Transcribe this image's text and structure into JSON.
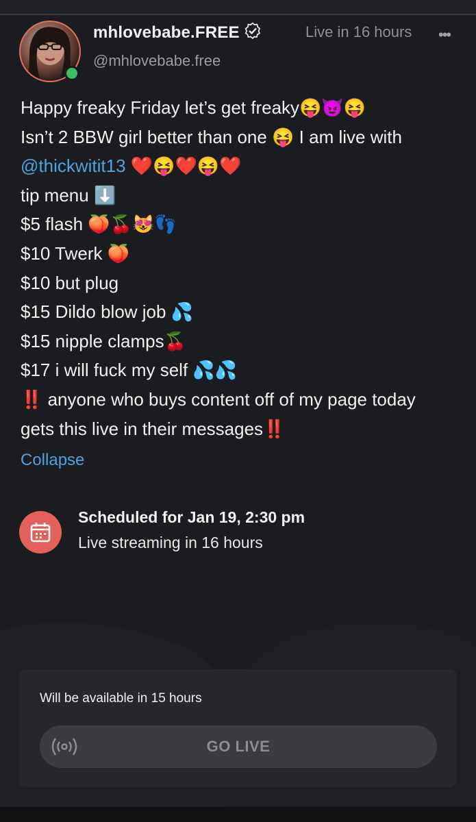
{
  "header": {
    "username": "mhlovebabe.FREE",
    "handle": "@mhlovebabe.free",
    "live_status": "Live in 16 hours",
    "more_label": "•••"
  },
  "post": {
    "lines": [
      "Happy freaky Friday let’s get freaky😝😈😝",
      "Isn’t 2 BBW girl better than one 😝 I am live with",
      {
        "mention": "@thickwitit13",
        "rest": " ❤️😝❤️😝❤️"
      },
      "tip menu ⬇️",
      "$5 flash 🍑🍒😻👣",
      "$10 Twerk 🍑",
      "$10 but plug",
      "$15 Dildo blow job 💦",
      "$15 nipple clamps🍒",
      "$17 i will fuck my self 💦💦",
      "‼️ anyone who buys content off of my page today",
      "gets this live in their messages‼️"
    ],
    "collapse_label": "Collapse"
  },
  "schedule": {
    "title": "Scheduled for Jan 19, 2:30 pm",
    "subtitle": "Live streaming in 16 hours",
    "icon": "calendar-icon"
  },
  "availability": {
    "text": "Will be available in 15 hours",
    "button_label": "GO LIVE",
    "button_icon": "broadcast-icon"
  },
  "colors": {
    "background": "#1b1c1f",
    "accent_link": "#4aa3df",
    "schedule_icon_bg": "#e4605a",
    "online": "#3bbf5e"
  }
}
